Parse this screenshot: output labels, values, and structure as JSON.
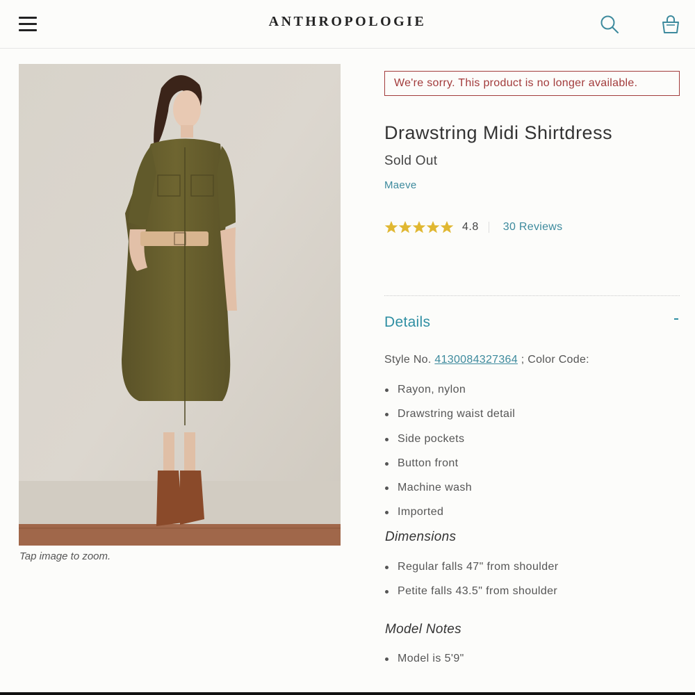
{
  "header": {
    "logo": "ANTHROPOLOGIE",
    "menu_icon": "hamburger-menu-icon",
    "search_icon": "search-icon",
    "bag_icon": "shopping-bag-icon"
  },
  "product": {
    "image_alt": "Model wearing olive drawstring midi shirtdress",
    "zoom_hint": "Tap image to zoom.",
    "availability_alert": "We're sorry. This product is no longer available.",
    "title": "Drawstring Midi Shirtdress",
    "status": "Sold Out",
    "brand": "Maeve",
    "rating": {
      "value": "4.8",
      "stars": 5,
      "reviews_label": "30 Reviews"
    }
  },
  "details": {
    "title": "Details",
    "toggle_symbol": "-",
    "style_prefix": "Style No.",
    "style_number": "4130084327364",
    "style_suffix": "; Color Code:",
    "features": [
      "Rayon, nylon",
      "Drawstring waist detail",
      "Side pockets",
      "Button front",
      "Machine wash",
      "Imported"
    ],
    "dimensions_title": "Dimensions",
    "dimensions": [
      "Regular falls 47\" from shoulder",
      "Petite falls 43.5\" from shoulder"
    ],
    "model_notes_title": "Model Notes",
    "model_notes": [
      "Model is 5'9\""
    ]
  },
  "colors": {
    "accent": "#2f8fa3",
    "link": "#3d8a9d",
    "alert": "#a23b3b",
    "star": "#e0b731"
  }
}
